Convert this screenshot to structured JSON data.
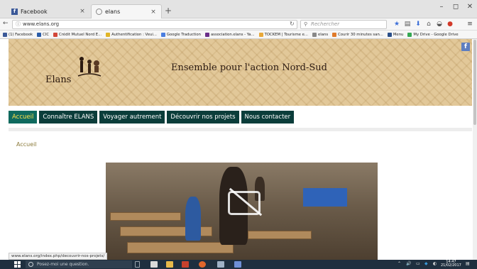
{
  "browser": {
    "tabs": [
      {
        "title": "Facebook",
        "favicon": "facebook-icon"
      },
      {
        "title": "elans",
        "favicon": "globe-icon"
      }
    ],
    "new_tab": "+",
    "close_glyph": "×",
    "url": "www.elans.org",
    "search_placeholder": "Rechercher",
    "window_controls": [
      "–",
      "◻",
      "✕"
    ]
  },
  "bookmarks": [
    {
      "label": "(1) Facebook",
      "color": "#3b5998"
    },
    {
      "label": "CIC",
      "color": "#2a5ca8"
    },
    {
      "label": "Crédit Mutuel Nord E...",
      "color": "#d2473a"
    },
    {
      "label": "Authentification : Veui...",
      "color": "#e0b528"
    },
    {
      "label": "Google Traduction",
      "color": "#4a7ee0"
    },
    {
      "label": "association.elans - Ya...",
      "color": "#6b2f8a"
    },
    {
      "label": "TOCKEM | Tourisme e...",
      "color": "#e8a83a"
    },
    {
      "label": "elans",
      "color": "#888888"
    },
    {
      "label": "Courir 30 minutes san...",
      "color": "#e07a2a"
    },
    {
      "label": "Menu",
      "color": "#2a4f8a"
    },
    {
      "label": "My Drive - Google Drive",
      "color": "#35a853"
    }
  ],
  "site": {
    "logo_text": "Elans",
    "title": "Ensemble pour l'action Nord-Sud",
    "facebook_badge": "f",
    "menu": [
      {
        "label": "Accueil",
        "active": true
      },
      {
        "label": "Connaître ELANS",
        "active": false
      },
      {
        "label": "Voyager autrement",
        "active": false
      },
      {
        "label": "Découvrir nos projets",
        "active": false
      },
      {
        "label": "Nous contacter",
        "active": false
      }
    ],
    "breadcrumb": "Accueil"
  },
  "status_url": "www.elans.org/index.php/decouvrir-nos-projets/",
  "taskbar": {
    "search_placeholder": "Posez-moi une question.",
    "clock_time": "14:47",
    "clock_date": "21/02/2017"
  },
  "colors": {
    "menu_bg": "#0b3d3a",
    "menu_active_bg": "#0f6a5e",
    "menu_active_text": "#ffe04a",
    "banner": "#e2c899"
  }
}
